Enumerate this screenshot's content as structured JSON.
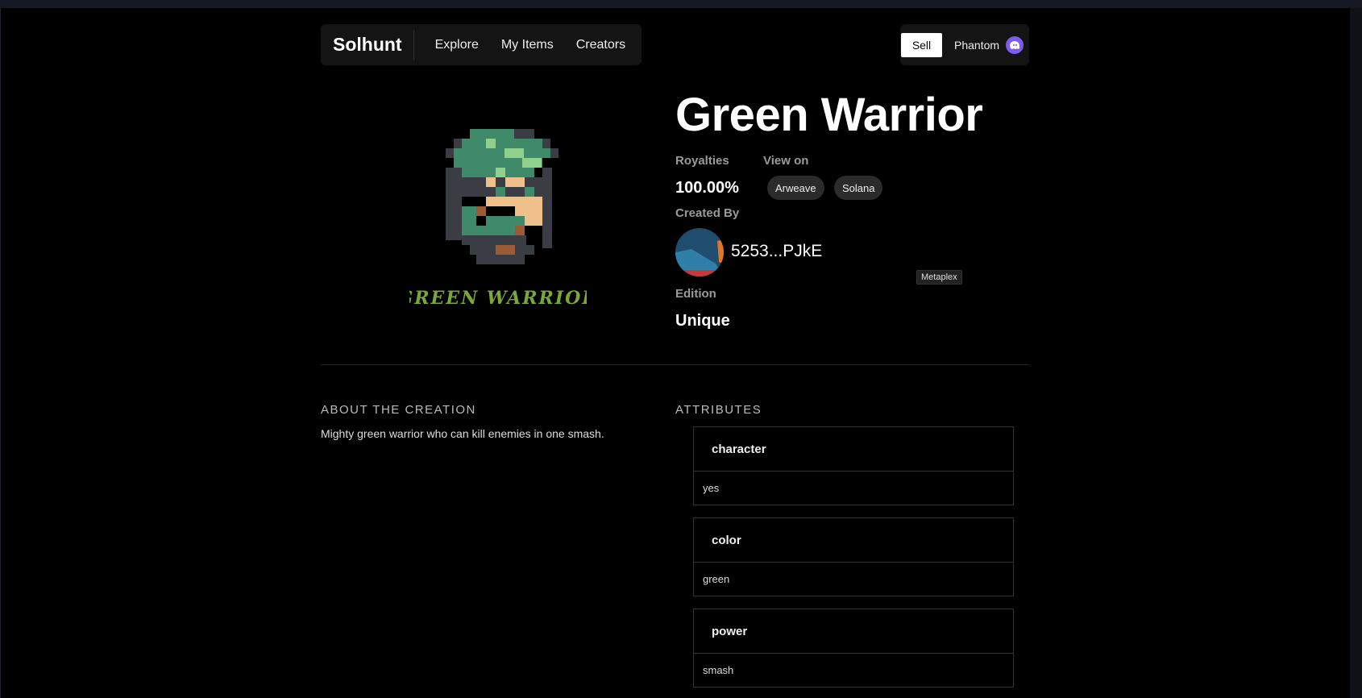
{
  "nav": {
    "brand": "Solhunt",
    "links": [
      "Explore",
      "My Items",
      "Creators"
    ],
    "sell_label": "Sell",
    "wallet_label": "Phantom"
  },
  "artwork": {
    "caption": "GREEN WARRIOR"
  },
  "item": {
    "title": "Green Warrior",
    "royalties_label": "Royalties",
    "royalties_value": "100.00%",
    "view_on_label": "View on",
    "view_on_links": [
      "Arweave",
      "Solana"
    ],
    "created_by_label": "Created By",
    "creator_address": "5253...PJkE",
    "creator_tag": "Metaplex",
    "edition_label": "Edition",
    "edition_value": "Unique"
  },
  "about": {
    "heading": "ABOUT THE CREATION",
    "text": "Mighty green warrior who can kill enemies in one smash."
  },
  "attributes": {
    "heading": "ATTRIBUTES",
    "items": [
      {
        "key": "character",
        "value": "yes"
      },
      {
        "key": "color",
        "value": "green"
      },
      {
        "key": "power",
        "value": "smash"
      }
    ]
  },
  "colors": {
    "background": "#000000",
    "pill": "#2b2b2b",
    "wallet_accent": "#7c5cf0",
    "caption_green": "#7aa63a"
  }
}
